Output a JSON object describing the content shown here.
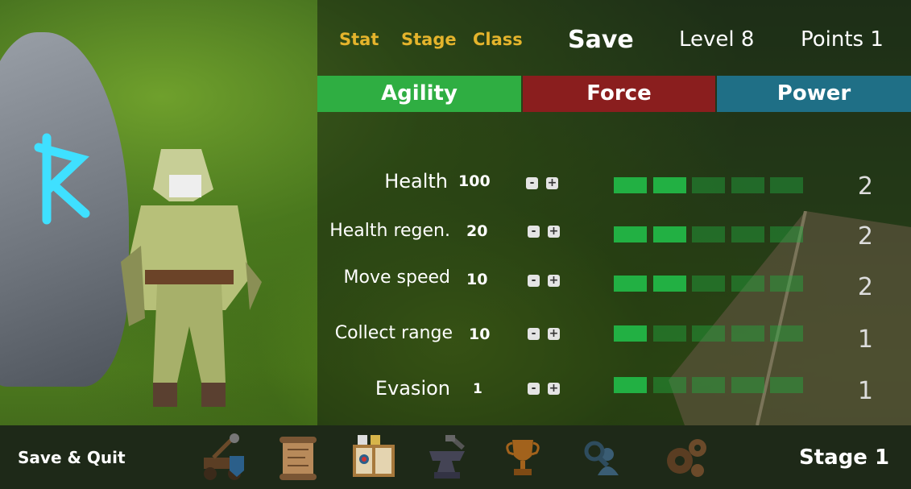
{
  "nav": {
    "stat": "Stat",
    "stage": "Stage",
    "class": "Class",
    "save": "Save",
    "level": "Level 8",
    "points": "Points 1"
  },
  "tabs": [
    {
      "label": "Agility",
      "color": "#2fae42",
      "selected": true
    },
    {
      "label": "Force",
      "color": "#8a1e1e",
      "selected": false
    },
    {
      "label": "Power",
      "color": "#1f6f86",
      "selected": false
    }
  ],
  "stats": [
    {
      "name": "Health",
      "value": "100",
      "level": "2",
      "filled": 2,
      "max": 5
    },
    {
      "name": "Health regen.",
      "value": "20",
      "level": "2",
      "filled": 2,
      "max": 5
    },
    {
      "name": "Move speed",
      "value": "10",
      "level": "2",
      "filled": 2,
      "max": 5
    },
    {
      "name": "Collect range",
      "value": "10",
      "level": "1",
      "filled": 1,
      "max": 5
    },
    {
      "name": "Evasion",
      "value": "1",
      "level": "1",
      "filled": 1,
      "max": 5
    }
  ],
  "buttons": {
    "minus": "-",
    "plus": "+"
  },
  "bottom": {
    "save_quit": "Save & Quit",
    "stage": "Stage 1",
    "icons": [
      "catapult-icon",
      "scroll-map-icon",
      "spellbook-icon",
      "anvil-icon",
      "trophy-icon",
      "search-people-icon",
      "gears-icon"
    ]
  },
  "colors": {
    "filled_bar": "#22b043",
    "empty_bar": "rgba(34,176,67,0.42)",
    "accent_link": "#e4b42c"
  }
}
